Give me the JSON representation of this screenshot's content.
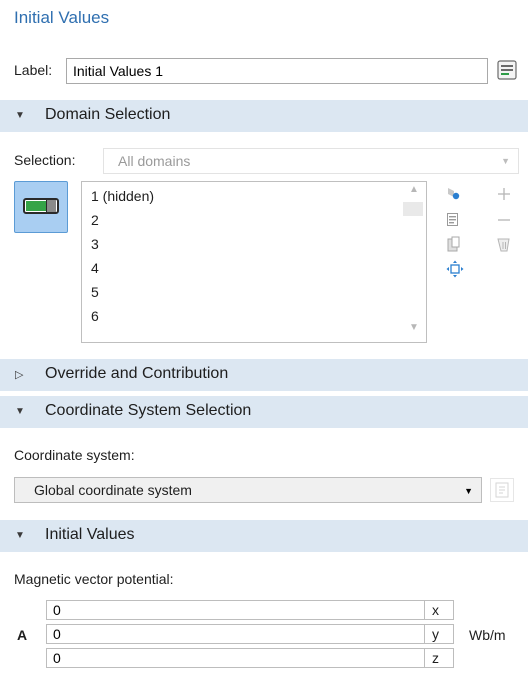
{
  "panel": {
    "title": "Initial Values"
  },
  "label_row": {
    "label": "Label:",
    "value": "Initial Values 1"
  },
  "sections": {
    "domain": "Domain Selection",
    "override": "Override and Contribution",
    "coord": "Coordinate System Selection",
    "initial": "Initial Values"
  },
  "selection": {
    "label": "Selection:",
    "value": "All domains",
    "items": [
      "1 (hidden)",
      "2",
      "3",
      "4",
      "5",
      "6"
    ]
  },
  "coordinate": {
    "label": "Coordinate system:",
    "value": "Global coordinate system"
  },
  "initial_values": {
    "label": "Magnetic vector potential:",
    "symbol": "A",
    "unit": "Wb/m",
    "components": [
      {
        "value": "0",
        "axis": "x"
      },
      {
        "value": "0",
        "axis": "y"
      },
      {
        "value": "0",
        "axis": "z"
      }
    ]
  },
  "colors": {
    "title": "#2f6fb0",
    "section_bg": "#dce7f2",
    "toggle_bg": "#a9cef2",
    "toggle_on": "#35a447"
  },
  "icons": [
    "label-settings-icon",
    "domain-toggle-icon",
    "paste-selection-icon",
    "copy-selection-icon",
    "clear-selection-icon",
    "zoom-to-selection-icon",
    "add-icon",
    "remove-icon",
    "delete-icon",
    "coordinate-settings-icon"
  ]
}
